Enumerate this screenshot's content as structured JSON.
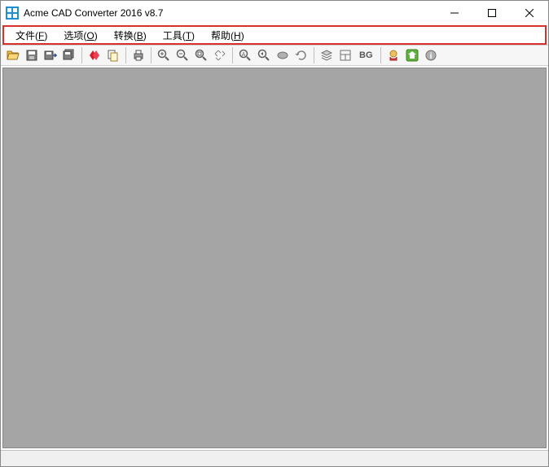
{
  "title": "Acme CAD Converter 2016 v8.7",
  "menu": {
    "file": "文件(F)",
    "options": "选项(O)",
    "convert": "转换(B)",
    "tools": "工具(T)",
    "help": "帮助(H)"
  },
  "toolbar": {
    "bg_label": "BG"
  }
}
